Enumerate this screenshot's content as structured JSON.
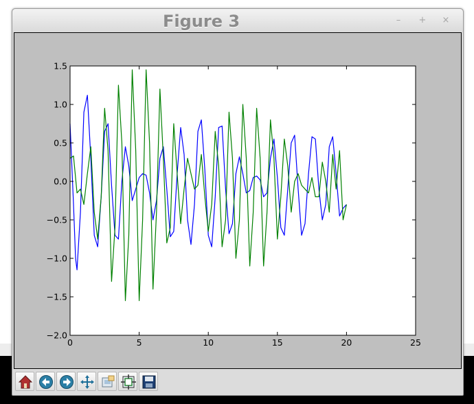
{
  "window": {
    "title": "Figure 3",
    "controls": {
      "minimize": "–",
      "maximize": "+",
      "close": "×"
    }
  },
  "toolbar": {
    "buttons": [
      {
        "name": "home",
        "icon": "home-icon"
      },
      {
        "name": "back",
        "icon": "back-arrow-icon"
      },
      {
        "name": "forward",
        "icon": "forward-arrow-icon"
      },
      {
        "name": "pan",
        "icon": "pan-move-icon"
      },
      {
        "name": "zoom",
        "icon": "zoom-rect-icon"
      },
      {
        "name": "subplots",
        "icon": "configure-subplots-icon"
      },
      {
        "name": "save",
        "icon": "save-floppy-icon"
      }
    ]
  },
  "colors": {
    "figure_background": "#bfbfbf",
    "axes_background": "#ffffff",
    "series_1": "#0000ff",
    "series_2": "#008000"
  },
  "chart_data": {
    "type": "line",
    "title": "",
    "xlabel": "",
    "ylabel": "",
    "xlim": [
      0,
      25
    ],
    "ylim": [
      -2.0,
      1.5
    ],
    "x_ticks": [
      0,
      5,
      10,
      15,
      20,
      25
    ],
    "x_tick_labels": [
      "0",
      "5",
      "10",
      "15",
      "20",
      "25"
    ],
    "y_ticks": [
      1.5,
      1.0,
      0.5,
      0.0,
      -0.5,
      -1.0,
      -1.5,
      -2.0
    ],
    "y_tick_labels": [
      "1.5",
      "1.0",
      "0.5",
      "0.0",
      "−0.5",
      "−1.0",
      "−1.5",
      "−2.0"
    ],
    "grid": false,
    "legend": "none",
    "series": [
      {
        "color": "#0000ff",
        "x": [
          0.0,
          0.25,
          0.4,
          0.5,
          0.75,
          1.0,
          1.25,
          1.5,
          1.75,
          2.0,
          2.25,
          2.5,
          2.75,
          3.0,
          3.25,
          3.5,
          3.75,
          4.0,
          4.25,
          4.5,
          4.75,
          5.0,
          5.25,
          5.5,
          5.75,
          6.0,
          6.25,
          6.5,
          6.75,
          7.0,
          7.25,
          7.5,
          7.75,
          8.0,
          8.25,
          8.5,
          8.75,
          9.0,
          9.25,
          9.5,
          9.75,
          10.0,
          10.25,
          10.5,
          10.75,
          11.0,
          11.25,
          11.5,
          11.75,
          12.0,
          12.25,
          12.5,
          12.75,
          13.0,
          13.25,
          13.5,
          13.75,
          14.0,
          14.25,
          14.5,
          14.75,
          15.0,
          15.25,
          15.5,
          15.75,
          16.0,
          16.25,
          16.5,
          16.75,
          17.0,
          17.25,
          17.5,
          17.75,
          18.0,
          18.25,
          18.5,
          18.75,
          19.0,
          19.25,
          19.5,
          19.75,
          20.0
        ],
        "y": [
          0.75,
          -0.3,
          -1.0,
          -1.15,
          -0.4,
          0.9,
          1.12,
          0.3,
          -0.7,
          -0.85,
          -0.2,
          0.65,
          0.75,
          -0.05,
          -0.7,
          -0.75,
          0.0,
          0.45,
          0.2,
          -0.25,
          -0.1,
          0.05,
          0.1,
          0.08,
          -0.15,
          -0.5,
          -0.25,
          0.3,
          0.45,
          -0.1,
          -0.72,
          -0.65,
          0.1,
          0.7,
          0.35,
          -0.5,
          -0.82,
          -0.3,
          0.65,
          0.8,
          0.15,
          -0.7,
          -0.85,
          -0.2,
          0.7,
          0.72,
          -0.1,
          -0.68,
          -0.55,
          0.1,
          0.32,
          0.1,
          -0.15,
          -0.12,
          0.05,
          0.07,
          0.02,
          -0.2,
          -0.15,
          0.3,
          0.55,
          0.05,
          -0.6,
          -0.7,
          -0.1,
          0.5,
          0.6,
          -0.1,
          -0.7,
          -0.55,
          0.1,
          0.58,
          0.55,
          -0.1,
          -0.5,
          -0.3,
          0.45,
          0.58,
          0.1,
          -0.45,
          -0.35,
          -0.3
        ]
      },
      {
        "color": "#008000",
        "x": [
          0.0,
          0.25,
          0.5,
          0.75,
          1.0,
          1.25,
          1.5,
          1.75,
          2.0,
          2.25,
          2.5,
          2.75,
          3.0,
          3.25,
          3.5,
          3.75,
          4.0,
          4.25,
          4.5,
          4.75,
          5.0,
          5.25,
          5.5,
          5.75,
          6.0,
          6.25,
          6.5,
          6.75,
          7.0,
          7.25,
          7.5,
          7.75,
          8.0,
          8.25,
          8.5,
          8.75,
          9.0,
          9.25,
          9.5,
          9.75,
          10.0,
          10.25,
          10.5,
          10.75,
          11.0,
          11.25,
          11.5,
          11.75,
          12.0,
          12.25,
          12.5,
          12.75,
          13.0,
          13.25,
          13.5,
          13.75,
          14.0,
          14.25,
          14.5,
          14.75,
          15.0,
          15.25,
          15.5,
          15.75,
          16.0,
          16.25,
          16.5,
          16.75,
          17.0,
          17.25,
          17.5,
          17.75,
          18.0,
          18.25,
          18.5,
          18.75,
          19.0,
          19.25,
          19.5,
          19.75,
          20.0
        ],
        "y": [
          0.3,
          0.33,
          -0.15,
          -0.1,
          -0.3,
          0.1,
          0.45,
          -0.4,
          -0.75,
          -0.2,
          0.95,
          0.4,
          -1.3,
          -0.6,
          1.25,
          0.5,
          -1.55,
          -0.7,
          1.45,
          0.4,
          -1.55,
          -0.5,
          1.45,
          0.5,
          -1.4,
          -0.4,
          1.2,
          0.3,
          -0.8,
          -0.6,
          0.75,
          0.1,
          -0.55,
          -0.1,
          0.3,
          0.1,
          -0.1,
          -0.05,
          0.35,
          -0.2,
          -0.65,
          -0.3,
          0.65,
          0.2,
          -0.85,
          -0.5,
          0.9,
          0.3,
          -1.0,
          -0.5,
          1.0,
          0.3,
          -1.1,
          -0.4,
          0.95,
          0.3,
          -1.1,
          -0.4,
          0.8,
          0.3,
          -0.75,
          -0.2,
          0.55,
          0.2,
          -0.4,
          0.0,
          0.1,
          -0.05,
          -0.1,
          -0.15,
          0.05,
          -0.2,
          -0.2,
          0.25,
          0.0,
          -0.4,
          0.35,
          -0.1,
          0.4,
          -0.5,
          -0.3
        ]
      }
    ]
  }
}
